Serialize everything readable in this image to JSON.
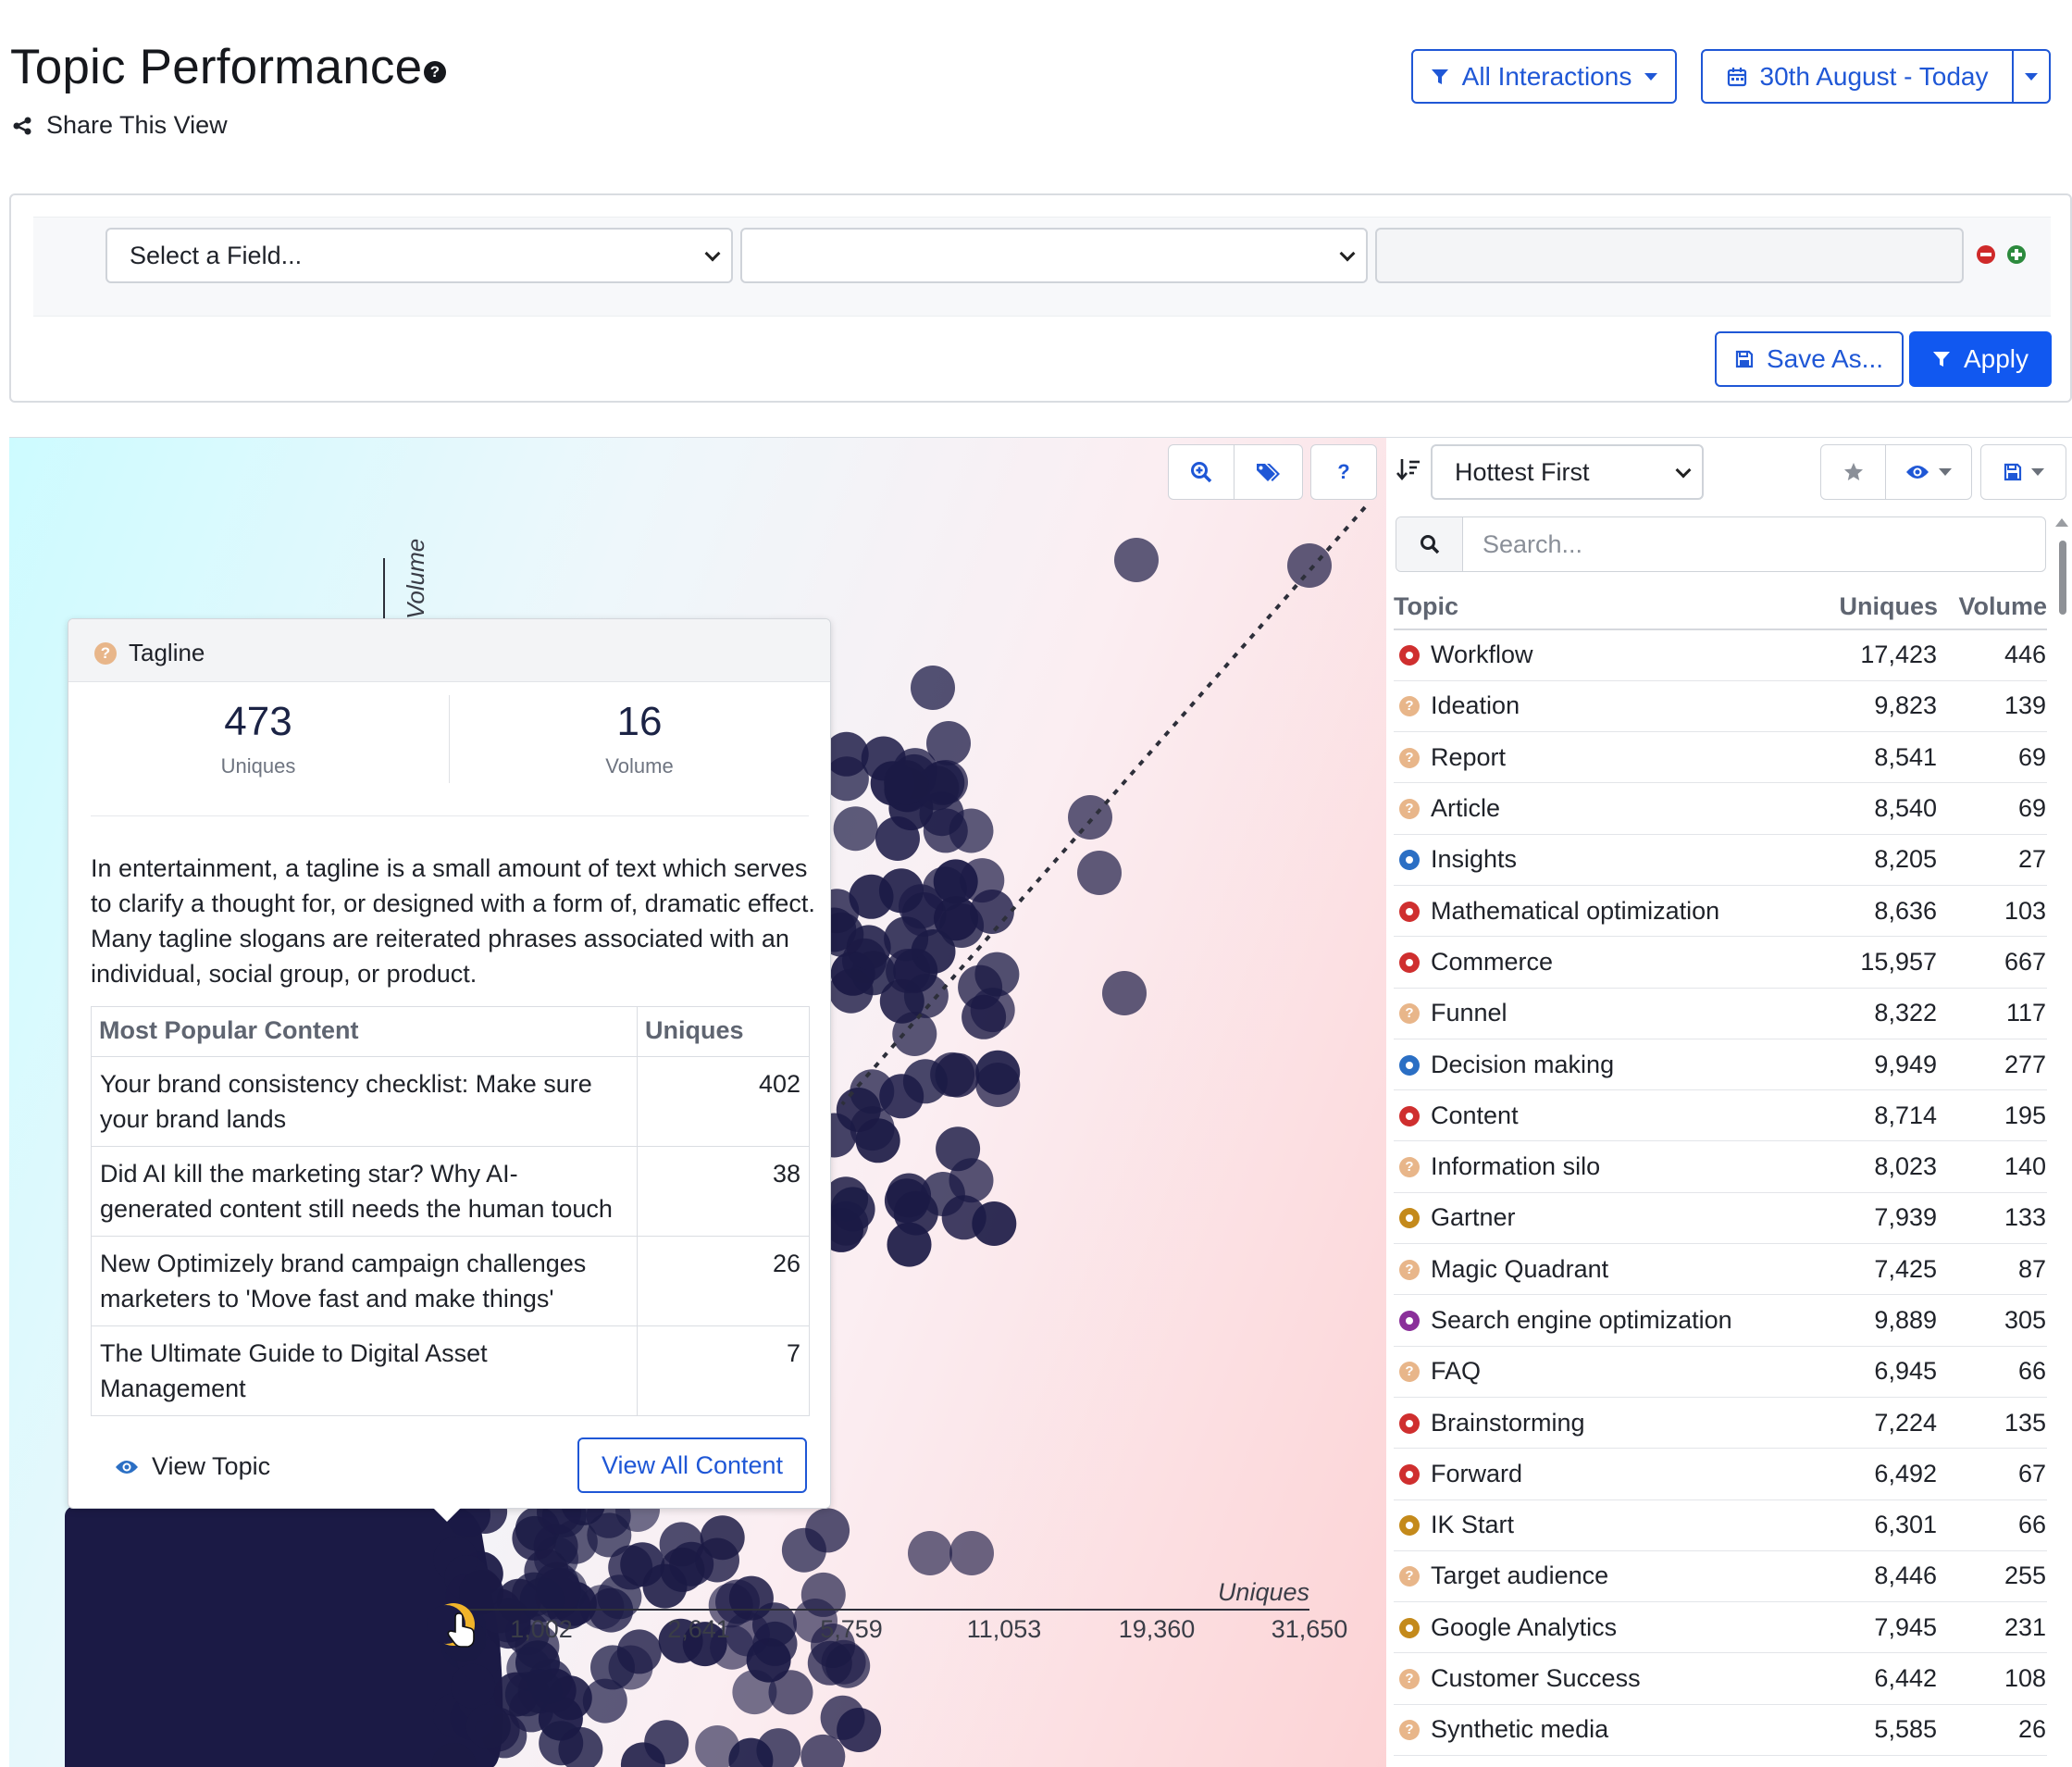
{
  "header": {
    "title": "Topic Performance",
    "share_label": "Share This View",
    "interactions_label": "All Interactions",
    "date_range_label": "30th August - Today"
  },
  "filter": {
    "field_placeholder": "Select a Field...",
    "operator_value": "",
    "value": "",
    "save_as_label": "Save As...",
    "apply_label": "Apply"
  },
  "toolbar": {
    "help_label": "?",
    "sort_value": "Hottest First",
    "search_placeholder": "Search..."
  },
  "chart_data": {
    "type": "scatter",
    "ylabel": "Volume",
    "xlabel": "Uniques",
    "x_ticks": [
      "1,002",
      "2,641",
      "5,759",
      "11,053",
      "19,360",
      "31,650"
    ],
    "point_color": "#1b1a45",
    "highlight_color": "#f0b42a"
  },
  "tooltip": {
    "title": "Tagline",
    "uniques": "473",
    "uniques_label": "Uniques",
    "volume": "16",
    "volume_label": "Volume",
    "description": "In entertainment, a tagline is a small amount of text which serves to clarify a thought for, or designed with a form of, dramatic effect. Many tagline slogans are reiterated phrases associated with an individual, social group, or product.",
    "table_header": [
      "Most Popular Content",
      "Uniques"
    ],
    "content_rows": [
      {
        "title": "Your brand consistency checklist: Make sure your brand lands",
        "uniques": "402"
      },
      {
        "title": "Did AI kill the marketing star? Why AI-generated content still needs the human touch",
        "uniques": "38"
      },
      {
        "title": "New Optimizely brand campaign challenges marketers to 'Move fast and make things'",
        "uniques": "26"
      },
      {
        "title": "The Ultimate Guide to Digital Asset Management",
        "uniques": "7"
      }
    ],
    "view_topic_label": "View Topic",
    "view_all_label": "View All Content"
  },
  "topic_table": {
    "headers": [
      "Topic",
      "Uniques",
      "Volume"
    ],
    "rows": [
      {
        "icon": "red",
        "topic": "Workflow",
        "uniques": "17,423",
        "volume": "446"
      },
      {
        "icon": "peach",
        "topic": "Ideation",
        "uniques": "9,823",
        "volume": "139"
      },
      {
        "icon": "peach",
        "topic": "Report",
        "uniques": "8,541",
        "volume": "69"
      },
      {
        "icon": "peach",
        "topic": "Article",
        "uniques": "8,540",
        "volume": "69"
      },
      {
        "icon": "blue",
        "topic": "Insights",
        "uniques": "8,205",
        "volume": "27"
      },
      {
        "icon": "red",
        "topic": "Mathematical optimization",
        "uniques": "8,636",
        "volume": "103"
      },
      {
        "icon": "red",
        "topic": "Commerce",
        "uniques": "15,957",
        "volume": "667"
      },
      {
        "icon": "peach",
        "topic": "Funnel",
        "uniques": "8,322",
        "volume": "117"
      },
      {
        "icon": "blue",
        "topic": "Decision making",
        "uniques": "9,949",
        "volume": "277"
      },
      {
        "icon": "red",
        "topic": "Content",
        "uniques": "8,714",
        "volume": "195"
      },
      {
        "icon": "peach",
        "topic": "Information silo",
        "uniques": "8,023",
        "volume": "140"
      },
      {
        "icon": "gold",
        "topic": "Gartner",
        "uniques": "7,939",
        "volume": "133"
      },
      {
        "icon": "peach",
        "topic": "Magic Quadrant",
        "uniques": "7,425",
        "volume": "87"
      },
      {
        "icon": "purple",
        "topic": "Search engine optimization",
        "uniques": "9,889",
        "volume": "305"
      },
      {
        "icon": "peach",
        "topic": "FAQ",
        "uniques": "6,945",
        "volume": "66"
      },
      {
        "icon": "red",
        "topic": "Brainstorming",
        "uniques": "7,224",
        "volume": "135"
      },
      {
        "icon": "red",
        "topic": "Forward",
        "uniques": "6,492",
        "volume": "67"
      },
      {
        "icon": "gold",
        "topic": "IK Start",
        "uniques": "6,301",
        "volume": "66"
      },
      {
        "icon": "peach",
        "topic": "Target audience",
        "uniques": "8,446",
        "volume": "255"
      },
      {
        "icon": "gold",
        "topic": "Google Analytics",
        "uniques": "7,945",
        "volume": "231"
      },
      {
        "icon": "peach",
        "topic": "Customer Success",
        "uniques": "6,442",
        "volume": "108"
      },
      {
        "icon": "peach",
        "topic": "Synthetic media",
        "uniques": "5,585",
        "volume": "26"
      }
    ]
  }
}
